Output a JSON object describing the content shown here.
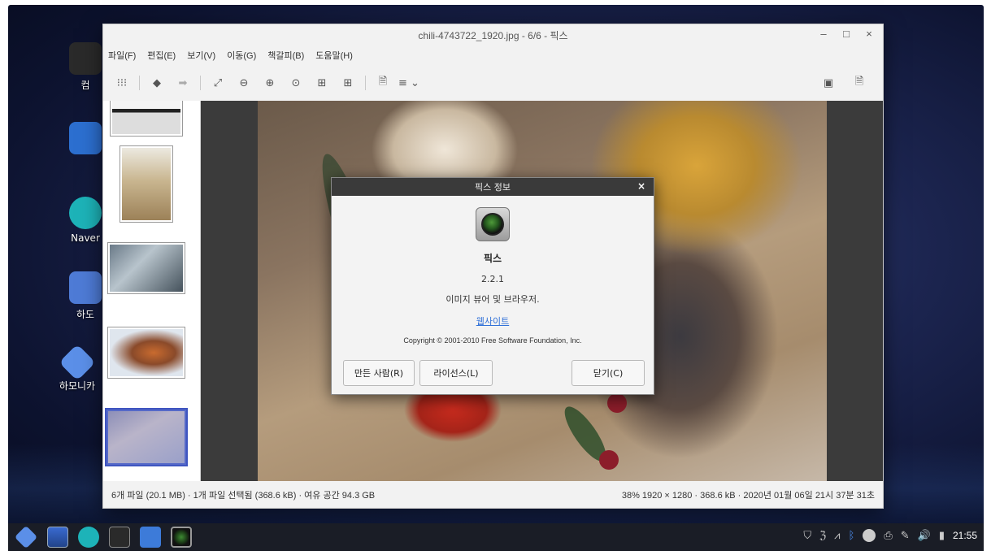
{
  "desktop": {
    "icons": [
      {
        "label": "컴"
      },
      {
        "label": ""
      },
      {
        "label": "Naver"
      },
      {
        "label": "하도"
      },
      {
        "label": "하모니카"
      }
    ]
  },
  "window": {
    "title": "chili-4743722_1920.jpg - 6/6 - 픽스",
    "controls": {
      "minimize": "–",
      "maximize": "□",
      "close": "×"
    },
    "menu": [
      "파일(F)",
      "편집(E)",
      "보기(V)",
      "이동(G)",
      "책갈피(B)",
      "도움말(H)"
    ]
  },
  "status": {
    "left": "6개 파일 (20.1 MB) · 1개 파일 선택됨 (368.6 kB) · 여유 공간 94.3 GB",
    "right": "38%  1920 × 1280 · 368.6 kB · 2020년 01월 06일 21시 37분 31초"
  },
  "dialog": {
    "title": "픽스 정보",
    "close": "×",
    "app_name": "픽스",
    "version": "2.2.1",
    "description": "이미지 뷰어 및 브라우저.",
    "website_link": "웹사이트",
    "copyright": "Copyright © 2001-2010 Free Software Foundation, Inc.",
    "buttons": {
      "credits": "만든 사람(R)",
      "license": "라이선스(L)",
      "close": "닫기(C)"
    }
  },
  "taskbar": {
    "clock": "21:55"
  },
  "colors": {
    "dialog_title_bg": "#3a3a3a",
    "link": "#3070d8",
    "thumb_selected": "#5569c8",
    "taskbar_bg": "#1a1d26"
  }
}
